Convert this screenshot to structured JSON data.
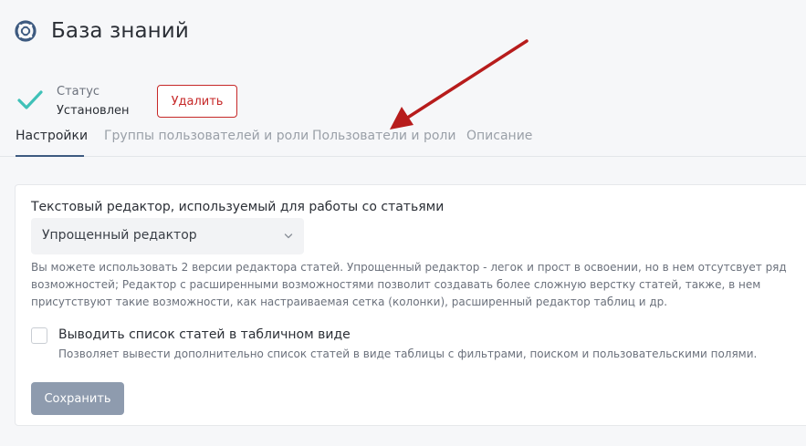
{
  "header": {
    "title": "База знаний",
    "logo_icon": "lifebuoy-icon"
  },
  "status": {
    "label": "Статус",
    "value": "Установлен",
    "icon": "checkmark-icon",
    "icon_color": "#3fc1b8"
  },
  "actions": {
    "delete_label": "Удалить"
  },
  "tabs": [
    {
      "label": "Настройки",
      "active": true
    },
    {
      "label": "Группы пользователей и роли",
      "active": false
    },
    {
      "label": "Пользователи и роли",
      "active": false
    },
    {
      "label": "Описание",
      "active": false
    }
  ],
  "settings": {
    "editor_label": "Текстовый редактор, используемый для работы со статьями",
    "editor_value": "Упрощенный редактор",
    "editor_help": "Вы можете использовать 2 версии редактора статей. Упрощенный редактор - легок и прост в освоении, но в нем отсутсвует ряд возможностей; Редактор с расширенными возможностями позволит создавать более сложную верстку статей, также, в нем присутствуют такие возможности, как настраиваемая сетка (колонки), расширенный редактор таблиц и др.",
    "table_view_label": "Выводить список статей в табличном виде",
    "table_view_description": "Позволяет вывести дополнительно список статей в виде таблицы с фильтрами, поиском и пользовательскими полями.",
    "table_view_checked": false,
    "save_label": "Сохранить"
  },
  "colors": {
    "accent": "#3d5a80",
    "danger": "#c62828",
    "annotation_arrow": "#b71c1c"
  }
}
